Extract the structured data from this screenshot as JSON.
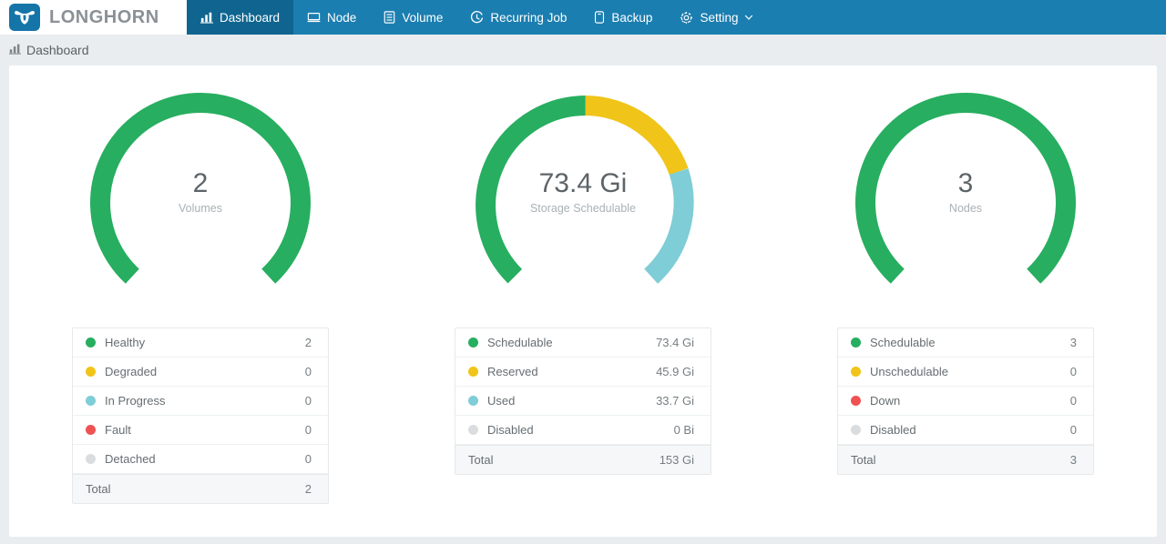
{
  "brand": {
    "name": "LONGHORN",
    "logo_icon": "longhorn-bull-icon",
    "logo_color": "#1574a8"
  },
  "nav": {
    "items": [
      {
        "label": "Dashboard",
        "icon": "chart-bar-icon",
        "active": true
      },
      {
        "label": "Node",
        "icon": "server-rack-icon",
        "active": false
      },
      {
        "label": "Volume",
        "icon": "database-icon",
        "active": false
      },
      {
        "label": "Recurring Job",
        "icon": "clock-icon",
        "active": false
      },
      {
        "label": "Backup",
        "icon": "archive-box-icon",
        "active": false
      },
      {
        "label": "Setting",
        "icon": "gear-icon",
        "active": false,
        "caret": "chevron-down-icon"
      }
    ]
  },
  "breadcrumb": {
    "icon": "chart-bar-icon",
    "label": "Dashboard"
  },
  "colors": {
    "green": "#27ae60",
    "yellow": "#f0c419",
    "lightblue": "#7fcdd6",
    "red": "#ee5253",
    "gray": "#d9dddf",
    "nav_bg": "#1b7eb0",
    "nav_active": "#0f658f",
    "page_bg": "#e9edef"
  },
  "panels": [
    {
      "gauge": {
        "value": "2",
        "label": "Volumes",
        "segments": [
          {
            "name": "Healthy",
            "color": "#27ae60",
            "fraction": 1.0
          }
        ]
      },
      "legend": {
        "rows": [
          {
            "name": "Healthy",
            "value": "2",
            "color": "#27ae60"
          },
          {
            "name": "Degraded",
            "value": "0",
            "color": "#f0c419"
          },
          {
            "name": "In Progress",
            "value": "0",
            "color": "#7fcdd6"
          },
          {
            "name": "Fault",
            "value": "0",
            "color": "#ee5253"
          },
          {
            "name": "Detached",
            "value": "0",
            "color": "#d9dddf"
          }
        ],
        "total": {
          "name": "Total",
          "value": "2"
        }
      }
    },
    {
      "gauge": {
        "value": "73.4 Gi",
        "label": "Storage Schedulable",
        "segments": [
          {
            "name": "Schedulable",
            "color": "#27ae60",
            "fraction": 0.48
          },
          {
            "name": "Reserved",
            "color": "#f0c419",
            "fraction": 0.3
          },
          {
            "name": "Used",
            "color": "#7fcdd6",
            "fraction": 0.22
          }
        ]
      },
      "legend": {
        "rows": [
          {
            "name": "Schedulable",
            "value": "73.4 Gi",
            "color": "#27ae60"
          },
          {
            "name": "Reserved",
            "value": "45.9 Gi",
            "color": "#f0c419"
          },
          {
            "name": "Used",
            "value": "33.7 Gi",
            "color": "#7fcdd6"
          },
          {
            "name": "Disabled",
            "value": "0 Bi",
            "color": "#d9dddf"
          }
        ],
        "total": {
          "name": "Total",
          "value": "153 Gi"
        }
      }
    },
    {
      "gauge": {
        "value": "3",
        "label": "Nodes",
        "segments": [
          {
            "name": "Schedulable",
            "color": "#27ae60",
            "fraction": 1.0
          }
        ]
      },
      "legend": {
        "rows": [
          {
            "name": "Schedulable",
            "value": "3",
            "color": "#27ae60"
          },
          {
            "name": "Unschedulable",
            "value": "0",
            "color": "#f0c419"
          },
          {
            "name": "Down",
            "value": "0",
            "color": "#ee5253"
          },
          {
            "name": "Disabled",
            "value": "0",
            "color": "#d9dddf"
          }
        ],
        "total": {
          "name": "Total",
          "value": "3"
        }
      }
    }
  ],
  "chart_data": {
    "type": "pie",
    "title": "Longhorn Dashboard gauges",
    "charts": [
      {
        "title": "Volumes",
        "center_value": "2",
        "categories": [
          "Healthy",
          "Degraded",
          "In Progress",
          "Fault",
          "Detached"
        ],
        "values": [
          2,
          0,
          0,
          0,
          0
        ],
        "total": 2,
        "colors": [
          "#27ae60",
          "#f0c419",
          "#7fcdd6",
          "#ee5253",
          "#d9dddf"
        ]
      },
      {
        "title": "Storage Schedulable",
        "center_value": "73.4 Gi",
        "categories": [
          "Schedulable",
          "Reserved",
          "Used",
          "Disabled"
        ],
        "values": [
          73.4,
          45.9,
          33.7,
          0
        ],
        "units": "Gi",
        "total": 153,
        "colors": [
          "#27ae60",
          "#f0c419",
          "#7fcdd6",
          "#d9dddf"
        ]
      },
      {
        "title": "Nodes",
        "center_value": "3",
        "categories": [
          "Schedulable",
          "Unschedulable",
          "Down",
          "Disabled"
        ],
        "values": [
          3,
          0,
          0,
          0
        ],
        "total": 3,
        "colors": [
          "#27ae60",
          "#f0c419",
          "#ee5253",
          "#d9dddf"
        ]
      }
    ]
  }
}
